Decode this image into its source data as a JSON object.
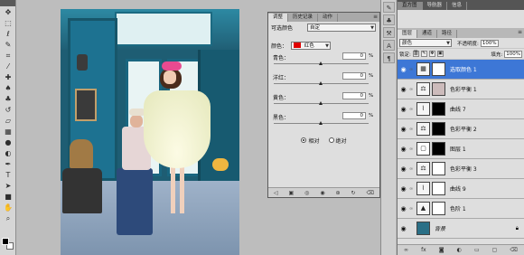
{
  "adjustments_panel": {
    "tabs": [
      "调整",
      "历史记录",
      "动作"
    ],
    "title": "可选颜色",
    "preset": "自定",
    "colors_label": "颜色：",
    "colors_value": "红色",
    "sliders": [
      {
        "label": "青色：",
        "value": "0",
        "unit": "%"
      },
      {
        "label": "洋红：",
        "value": "0",
        "unit": "%"
      },
      {
        "label": "黄色：",
        "value": "0",
        "unit": "%"
      },
      {
        "label": "黑色：",
        "value": "0",
        "unit": "%"
      }
    ],
    "methods": [
      {
        "label": "相对",
        "selected": true
      },
      {
        "label": "绝对",
        "selected": false
      }
    ]
  },
  "layers_panel": {
    "top_tabs": [
      "直方图",
      "导航器",
      "信息"
    ],
    "tabs": [
      "图层",
      "通道",
      "路径"
    ],
    "blend_mode": "颜色",
    "opacity_label": "不透明度:",
    "opacity_value": "100%",
    "lock_label": "锁定:",
    "fill_label": "填充:",
    "fill_value": "100%",
    "layers": [
      {
        "name": "选取颜色 1",
        "icon": "selective-color-icon",
        "mask": "white",
        "selected": true
      },
      {
        "name": "色彩平衡 1",
        "icon": "color-balance-icon",
        "mask": "photo",
        "selected": false
      },
      {
        "name": "曲线 7",
        "icon": "curves-icon",
        "mask": "black",
        "selected": false
      },
      {
        "name": "色彩平衡 2",
        "icon": "color-balance-icon",
        "mask": "black",
        "selected": false
      },
      {
        "name": "图层 1",
        "icon": "pixel-layer-icon",
        "mask": "black",
        "selected": false
      },
      {
        "name": "色彩平衡 3",
        "icon": "color-balance-icon",
        "mask": "white",
        "selected": false
      },
      {
        "name": "曲线 9",
        "icon": "curves-icon",
        "mask": "white",
        "selected": false
      },
      {
        "name": "色阶 1",
        "icon": "levels-icon",
        "mask": "white",
        "selected": false
      },
      {
        "name": "背景",
        "icon": "background-thumb",
        "mask": "none",
        "selected": false
      }
    ]
  },
  "colors": {
    "selection": "#3d77d6",
    "panel_bg": "#dedede",
    "workspace": "#bdbdbd",
    "red_chip": "#e00000"
  }
}
